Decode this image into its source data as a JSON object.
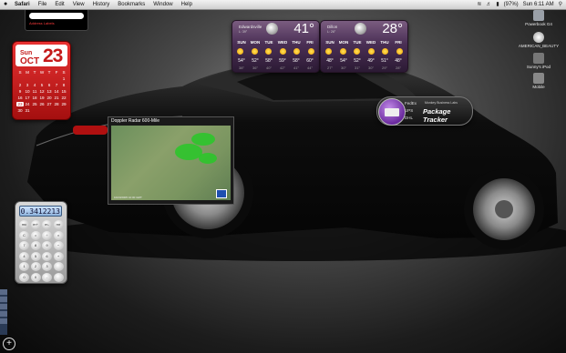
{
  "menubar": {
    "apple": "",
    "items": [
      "Safari",
      "File",
      "Edit",
      "View",
      "History",
      "Bookmarks",
      "Window",
      "Help"
    ],
    "clock": "Sun 6:11 AM",
    "battery": "(97%)"
  },
  "desktop_icons": [
    {
      "label": "Powerbook G4",
      "color": "#9aa0a8"
    },
    {
      "label": "AMERICAN_BEAUTY",
      "color": "#cfcfcf"
    },
    {
      "label": "Sunny's iPod",
      "color": "#777"
    },
    {
      "label": "Mobile",
      "color": "#888"
    }
  ],
  "address_widget": {
    "link": "Address Labels"
  },
  "calendar": {
    "weekday": "Sun",
    "month": "OCT",
    "day": "23",
    "headers": [
      "S",
      "M",
      "T",
      "W",
      "T",
      "F",
      "S"
    ],
    "days": [
      "",
      "",
      "",
      "",
      "",
      "",
      "1",
      "2",
      "3",
      "4",
      "5",
      "6",
      "7",
      "8",
      "9",
      "10",
      "11",
      "12",
      "13",
      "14",
      "15",
      "16",
      "17",
      "18",
      "19",
      "20",
      "21",
      "22",
      "23",
      "24",
      "25",
      "26",
      "27",
      "28",
      "29",
      "30",
      "31",
      "",
      "",
      "",
      ""
    ],
    "selected": "23"
  },
  "weather": [
    {
      "city": "Edwardsville",
      "hilo": "L: 39°",
      "temp": "41°",
      "days": [
        "SUN",
        "MON",
        "TUE",
        "WED",
        "THU",
        "FRI"
      ],
      "highs": [
        "54°",
        "52°",
        "58°",
        "59°",
        "58°",
        "60°"
      ],
      "lows": [
        "38°",
        "36°",
        "40°",
        "42°",
        "41°",
        "44°"
      ]
    },
    {
      "city": "Dillon",
      "hilo": "L: 26°",
      "temp": "28°",
      "days": [
        "SUN",
        "MON",
        "TUE",
        "WED",
        "THU",
        "FRI"
      ],
      "highs": [
        "48°",
        "54°",
        "52°",
        "49°",
        "51°",
        "48°"
      ],
      "lows": [
        "27°",
        "30°",
        "31°",
        "30°",
        "29°",
        "28°"
      ]
    }
  ],
  "package_tracker": {
    "carriers": [
      "FedEx",
      "UPS",
      "DHL"
    ],
    "brand": "Monkey Business Labs",
    "title": "Package Tracker"
  },
  "radar": {
    "title": "Doppler Radar 600-Mile",
    "timestamp": "10/23/2005 10:00 GMT"
  },
  "calculator": {
    "display": "0.3412213",
    "keys": [
      "mc",
      "m+",
      "m-",
      "mr",
      "C",
      "=",
      "÷",
      "×",
      "7",
      "8",
      "9",
      "−",
      "4",
      "5",
      "6",
      "+",
      "1",
      "2",
      "3",
      "",
      "0",
      "0",
      ".",
      ""
    ]
  },
  "dashboard": {
    "add_symbol": "+"
  }
}
